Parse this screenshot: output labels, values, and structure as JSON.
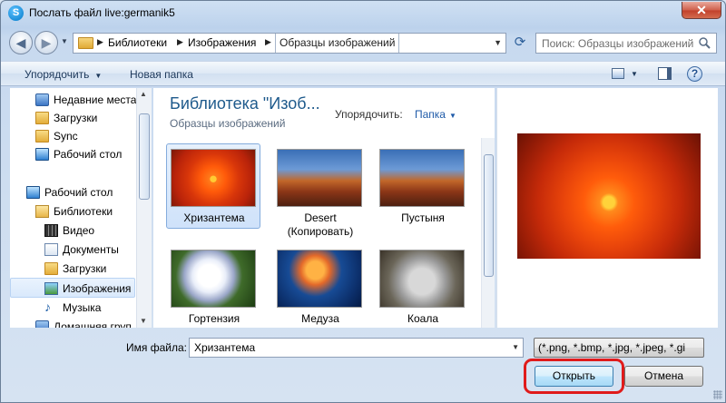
{
  "window": {
    "title": "Послать файл live:germanik5",
    "close_label": "✕"
  },
  "address": {
    "crumbs": [
      "Библиотеки",
      "Изображения",
      "Образцы изображений"
    ],
    "search_placeholder": "Поиск: Образцы изображений"
  },
  "toolbar": {
    "organize": "Упорядочить",
    "new_folder": "Новая папка"
  },
  "nav": {
    "items": [
      {
        "label": "Недавние места",
        "icon": "recent-places-icon"
      },
      {
        "label": "Загрузки",
        "icon": "downloads-folder-icon"
      },
      {
        "label": "Sync",
        "icon": "folder-icon"
      },
      {
        "label": "Рабочий стол",
        "icon": "desktop-icon"
      },
      {
        "label": "Рабочий стол",
        "icon": "desktop-icon"
      },
      {
        "label": "Библиотеки",
        "icon": "libraries-icon"
      },
      {
        "label": "Видео",
        "icon": "video-library-icon"
      },
      {
        "label": "Документы",
        "icon": "documents-library-icon"
      },
      {
        "label": "Загрузки",
        "icon": "downloads-folder-icon"
      },
      {
        "label": "Изображения",
        "icon": "pictures-library-icon"
      },
      {
        "label": "Музыка",
        "icon": "music-library-icon"
      },
      {
        "label": "Домашняя груп",
        "icon": "homegroup-icon"
      }
    ]
  },
  "library": {
    "title": "Библиотека \"Изоб...",
    "subtitle": "Образцы изображений",
    "arrange_label": "Упорядочить:",
    "arrange_value": "Папка"
  },
  "files": [
    {
      "label": "Хризантема"
    },
    {
      "label": "Desert\n(Копировать)"
    },
    {
      "label": "Пустыня"
    },
    {
      "label": "Гортензия"
    },
    {
      "label": "Медуза"
    },
    {
      "label": "Коала"
    }
  ],
  "footer": {
    "filename_label": "Имя файла:",
    "filename_value": "Хризантема",
    "filetype_value": "(*.png, *.bmp, *.jpg, *.jpeg, *.gi",
    "open_label": "Открыть",
    "cancel_label": "Отмена"
  },
  "colors": {
    "highlight_ring": "#e01b1b",
    "header_text": "#1e5a8c"
  }
}
